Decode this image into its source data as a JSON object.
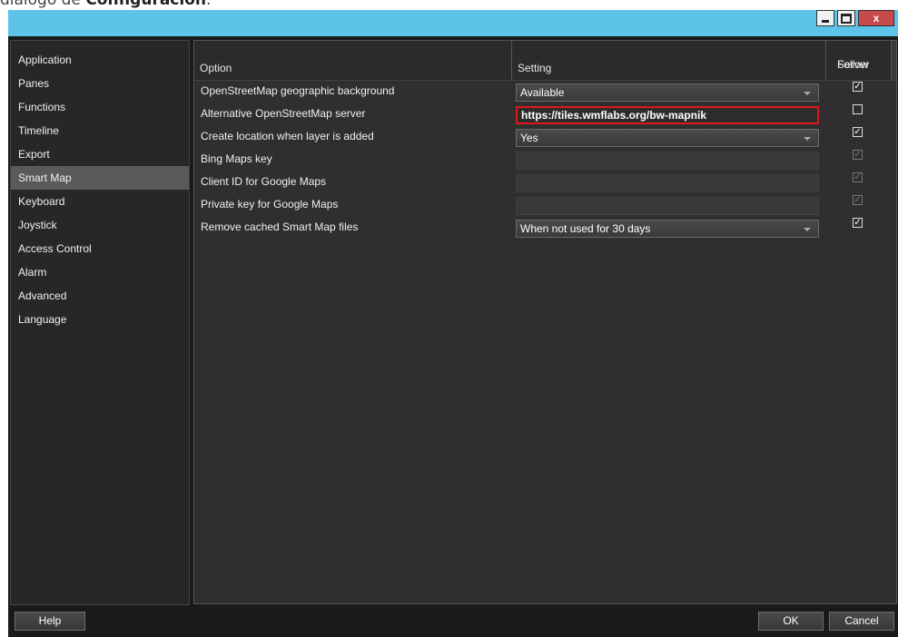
{
  "caption": {
    "prefix": "diálogo de ",
    "bold": "Configuración",
    "suffix": "."
  },
  "window": {
    "close_label": "x"
  },
  "sidebar": {
    "items": [
      {
        "label": "Application",
        "active": false
      },
      {
        "label": "Panes",
        "active": false
      },
      {
        "label": "Functions",
        "active": false
      },
      {
        "label": "Timeline",
        "active": false
      },
      {
        "label": "Export",
        "active": false
      },
      {
        "label": "Smart Map",
        "active": true
      },
      {
        "label": "Keyboard",
        "active": false
      },
      {
        "label": "Joystick",
        "active": false
      },
      {
        "label": "Access Control",
        "active": false
      },
      {
        "label": "Alarm",
        "active": false
      },
      {
        "label": "Advanced",
        "active": false
      },
      {
        "label": "Language",
        "active": false
      }
    ]
  },
  "table": {
    "headers": {
      "option": "Option",
      "setting": "Setting",
      "follow_line1": "Follow",
      "follow_line2": "Server"
    },
    "rows": [
      {
        "option": "OpenStreetMap geographic background",
        "type": "dropdown",
        "value": "Available",
        "follow_checked": true,
        "follow_enabled": true
      },
      {
        "option": "Alternative OpenStreetMap server",
        "type": "text",
        "value": "https://tiles.wmflabs.org/bw-mapnik",
        "highlighted": true,
        "follow_checked": false,
        "follow_enabled": true
      },
      {
        "option": "Create location when layer is added",
        "type": "dropdown",
        "value": "Yes",
        "follow_checked": true,
        "follow_enabled": true
      },
      {
        "option": "Bing Maps key",
        "type": "text",
        "value": "",
        "follow_checked": true,
        "follow_enabled": false
      },
      {
        "option": "Client ID for Google Maps",
        "type": "text",
        "value": "",
        "follow_checked": true,
        "follow_enabled": false
      },
      {
        "option": "Private key for Google Maps",
        "type": "text",
        "value": "",
        "follow_checked": true,
        "follow_enabled": false
      },
      {
        "option": "Remove cached Smart Map files",
        "type": "dropdown",
        "value": "When not used for 30 days",
        "follow_checked": true,
        "follow_enabled": true
      }
    ]
  },
  "footer": {
    "help_label": "Help",
    "ok_label": "OK",
    "cancel_label": "Cancel"
  },
  "colors": {
    "titlebar": "#5ec3e9",
    "highlight_border": "#e0161e",
    "active_nav": "#5a5a5a"
  }
}
